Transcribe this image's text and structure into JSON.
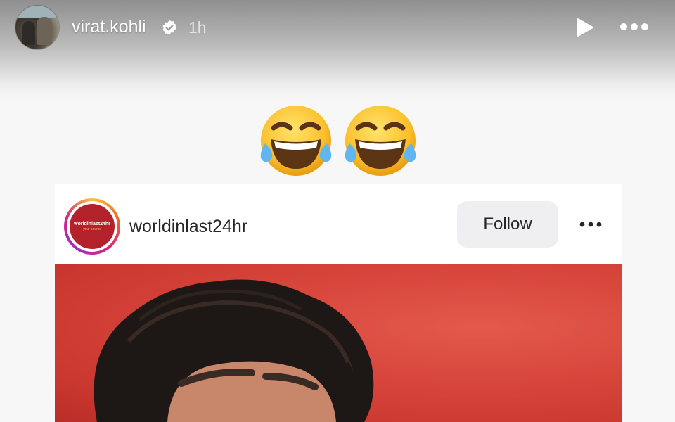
{
  "story": {
    "username": "virat.kohli",
    "time_ago": "1h",
    "icons": {
      "avatar": "profile-photo",
      "verified": "verified-badge-icon",
      "play": "play-icon",
      "more": "more-horizontal-icon"
    }
  },
  "content": {
    "emojis": [
      "😂",
      "😂"
    ]
  },
  "post": {
    "username": "worldinlast24hr",
    "avatar_logo_text": "worldinlast24hr",
    "avatar_logo_subtext": "your source",
    "follow_label": "Follow",
    "icons": {
      "more": "more-horizontal-icon"
    },
    "image": "portrait-photo-red-background"
  },
  "colors": {
    "ring_start": "#f9c23c",
    "ring_end": "#a12ccc",
    "image_bg": "#d8463c",
    "follow_bg": "#efeff1"
  }
}
